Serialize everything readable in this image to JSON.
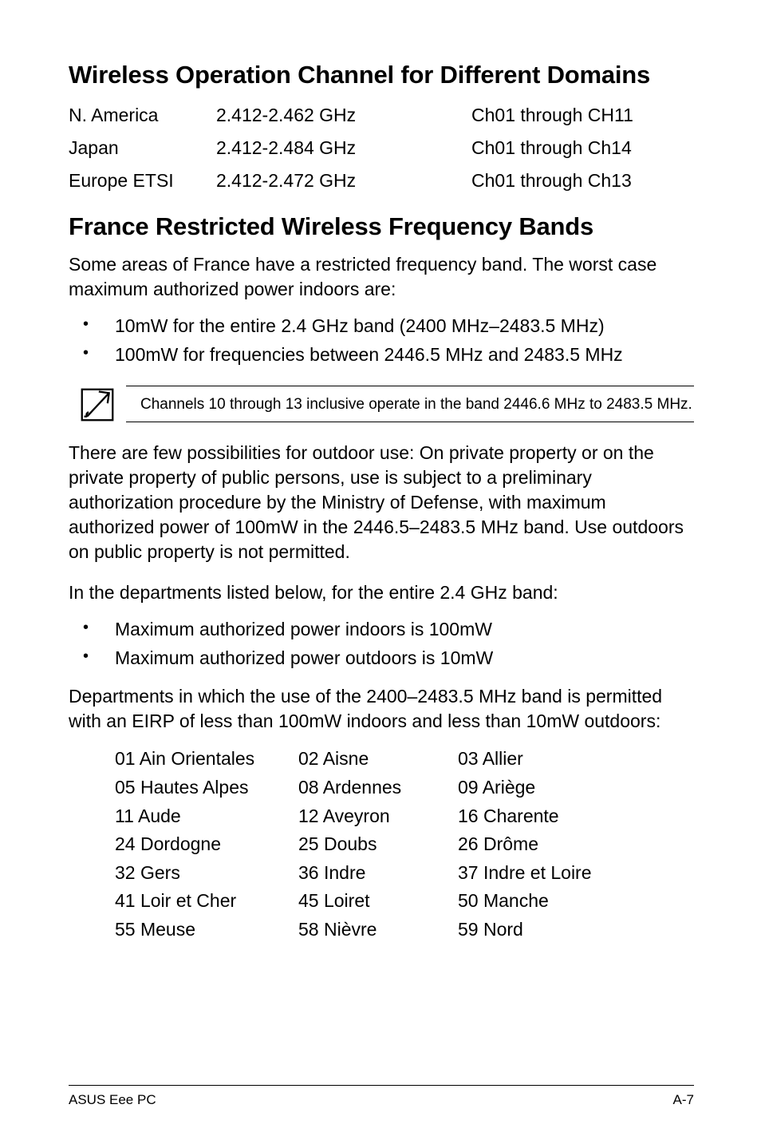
{
  "section1": {
    "title": "Wireless Operation Channel for Different Domains",
    "rows": [
      {
        "region": "N. America",
        "freq": "2.412-2.462 GHz",
        "channels": "Ch01 through CH11"
      },
      {
        "region": "Japan",
        "freq": "2.412-2.484 GHz",
        "channels": "Ch01 through Ch14"
      },
      {
        "region": "Europe ETSI",
        "freq": "2.412-2.472 GHz",
        "channels": "Ch01 through Ch13"
      }
    ]
  },
  "section2": {
    "title": "France Restricted Wireless Frequency Bands",
    "intro": "Some areas of France have a restricted frequency band. The worst case maximum authorized power indoors are:",
    "bullets1": [
      "10mW for the entire 2.4 GHz band (2400 MHz–2483.5 MHz)",
      "100mW for frequencies between 2446.5 MHz and 2483.5 MHz"
    ],
    "note": "Channels 10 through 13 inclusive operate in the band 2446.6 MHz to 2483.5 MHz.",
    "para2": "There are few possibilities for outdoor use: On private property or on the private property of public persons, use is subject to a preliminary authorization procedure by the Ministry of Defense, with maximum authorized power of 100mW in the 2446.5–2483.5 MHz band. Use outdoors on public property is not permitted.",
    "para3": "In the departments listed below, for the entire 2.4 GHz band:",
    "bullets2": [
      "Maximum authorized power indoors is 100mW",
      "Maximum authorized power outdoors is 10mW"
    ],
    "para4": "Departments in which the use of the 2400–2483.5 MHz band is permitted with an EIRP of less than 100mW indoors and less than 10mW outdoors:",
    "departments": [
      [
        "01  Ain Orientales",
        "02  Aisne",
        "03  Allier"
      ],
      [
        "05  Hautes Alpes",
        "08  Ardennes",
        "09  Ariège"
      ],
      [
        "11  Aude",
        "12  Aveyron",
        "16  Charente"
      ],
      [
        "24  Dordogne",
        "25  Doubs",
        "26  Drôme"
      ],
      [
        "32  Gers",
        "36  Indre",
        "37  Indre et Loire"
      ],
      [
        "41  Loir et Cher",
        "45  Loiret",
        "50  Manche"
      ],
      [
        "55  Meuse",
        "58  Nièvre",
        "59  Nord"
      ]
    ]
  },
  "footer": {
    "left": "ASUS Eee PC",
    "right": "A-7"
  }
}
